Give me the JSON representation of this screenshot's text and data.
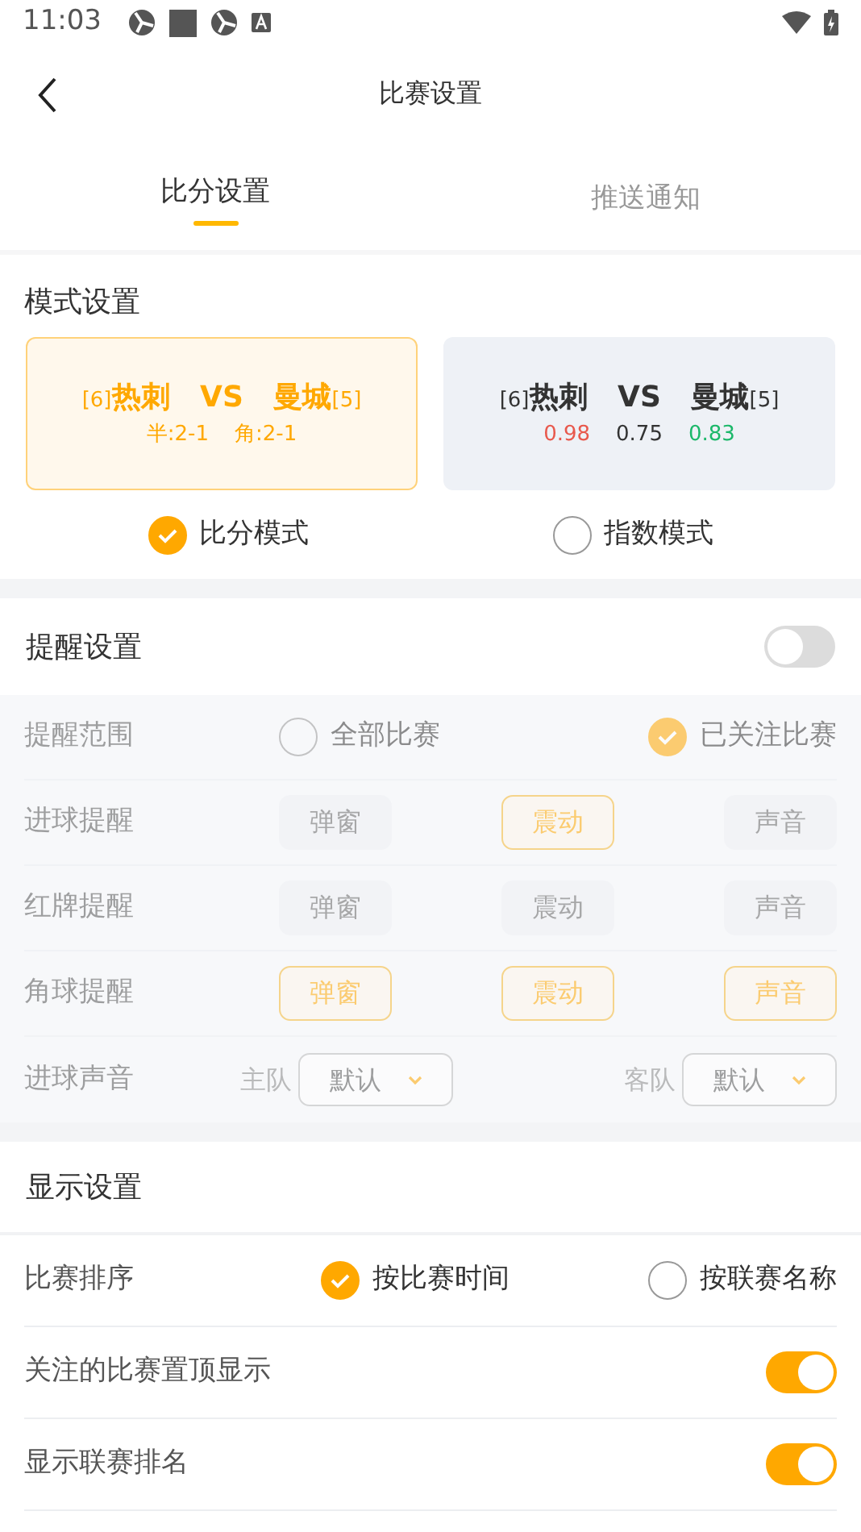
{
  "status_bar": {
    "time": "11:03"
  },
  "header": {
    "title": "比赛设置"
  },
  "tabs": [
    {
      "label": "比分设置",
      "selected": true
    },
    {
      "label": "推送通知",
      "selected": false
    }
  ],
  "mode_section": {
    "title": "模式设置",
    "modes": [
      {
        "kind": "score",
        "selected": true,
        "label": "比分模式",
        "home_rank": "[6]",
        "home": "热刺",
        "vs": "VS",
        "away": "曼城",
        "away_rank": "[5]",
        "details": [
          "半:2-1",
          "角:2-1"
        ]
      },
      {
        "kind": "index",
        "selected": false,
        "label": "指数模式",
        "home_rank": "[6]",
        "home": "热刺",
        "vs": "VS",
        "away": "曼城",
        "away_rank": "[5]",
        "odds": [
          {
            "value": "0.98",
            "color": "#e8584c"
          },
          {
            "value": "0.75",
            "color": "#333333"
          },
          {
            "value": "0.83",
            "color": "#1cb86a"
          }
        ]
      }
    ]
  },
  "reminder": {
    "title": "提醒设置",
    "on": false,
    "scope": {
      "label": "提醒范围",
      "options": [
        {
          "label": "全部比赛",
          "selected": false
        },
        {
          "label": "已关注比赛",
          "selected": true
        }
      ]
    },
    "alerts": [
      {
        "label": "进球提醒",
        "options": [
          {
            "label": "弹窗",
            "on": false
          },
          {
            "label": "震动",
            "on": true
          },
          {
            "label": "声音",
            "on": false
          }
        ]
      },
      {
        "label": "红牌提醒",
        "options": [
          {
            "label": "弹窗",
            "on": false
          },
          {
            "label": "震动",
            "on": false
          },
          {
            "label": "声音",
            "on": false
          }
        ]
      },
      {
        "label": "角球提醒",
        "options": [
          {
            "label": "弹窗",
            "on": true
          },
          {
            "label": "震动",
            "on": true
          },
          {
            "label": "声音",
            "on": true
          }
        ]
      }
    ],
    "sound": {
      "label": "进球声音",
      "pickers": [
        {
          "team": "主队",
          "value": "默认"
        },
        {
          "team": "客队",
          "value": "默认"
        }
      ]
    }
  },
  "display": {
    "title": "显示设置",
    "rows": [
      {
        "kind": "radio",
        "label": "比赛排序",
        "options": [
          {
            "label": "按比赛时间",
            "selected": true
          },
          {
            "label": "按联赛名称",
            "selected": false
          }
        ]
      },
      {
        "kind": "toggle",
        "label": "关注的比赛置顶显示",
        "on": true
      },
      {
        "kind": "toggle",
        "label": "显示联赛排名",
        "on": true
      }
    ]
  }
}
